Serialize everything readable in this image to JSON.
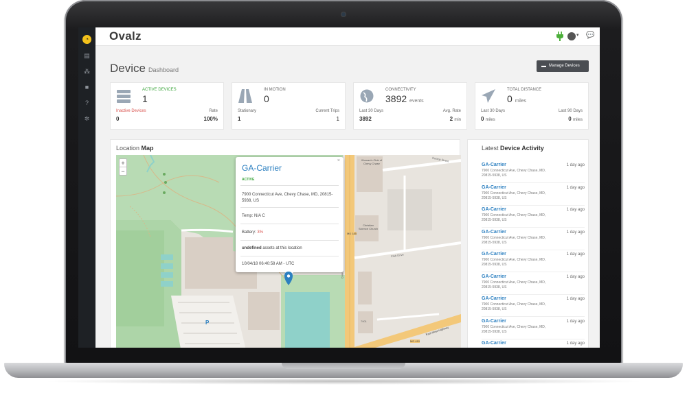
{
  "app": {
    "brand": "Ovalz"
  },
  "page": {
    "title": "Device",
    "subtitle": "Dashboard"
  },
  "toolbar": {
    "manage_devices_label": "Manage Devices"
  },
  "stats": [
    {
      "label": "Active Devices",
      "value": "1",
      "unit": "",
      "sub_left_label": "Inactive Devices",
      "sub_left_value": "0",
      "sub_left_unit": "",
      "sub_right_label": "Rate",
      "sub_right_value": "100%",
      "sub_right_unit": "",
      "icon": "server-icon"
    },
    {
      "label": "In Motion",
      "value": "0",
      "unit": "",
      "sub_left_label": "Stationary",
      "sub_left_value": "1",
      "sub_left_unit": "",
      "sub_right_label": "Current Trips",
      "sub_right_value": "1",
      "sub_right_unit": "",
      "icon": "road-icon"
    },
    {
      "label": "Connectivity",
      "value": "3892",
      "unit": "events",
      "sub_left_label": "Last 30 Days",
      "sub_left_value": "3892",
      "sub_left_unit": "",
      "sub_right_label": "Avg. Rate",
      "sub_right_value": "2",
      "sub_right_unit": "min",
      "icon": "globe-icon"
    },
    {
      "label": "Total Distance",
      "value": "0",
      "unit": "miles",
      "sub_left_label": "Last 30 Days",
      "sub_left_value": "0",
      "sub_left_unit": "miles",
      "sub_right_label": "Last 90 Days",
      "sub_right_value": "0",
      "sub_right_unit": "miles",
      "icon": "paper-plane-icon"
    }
  ],
  "map": {
    "title_prefix": "Location",
    "title_bold": "Map",
    "zoom_in": "+",
    "zoom_out": "−",
    "popup": {
      "title": "GA-Carrier",
      "status": "ACTIVE",
      "address": "7900 Connecticut Ave, Chevy Chase, MD, 20815-5938, US",
      "temp": "Temp: N/A C",
      "battery_label": "Battery:",
      "battery_value": "3%",
      "assets_bold": "undefined",
      "assets_rest": "assets at this location",
      "timestamp": "10/04/18 06:40:58 AM - UTC",
      "close": "×"
    },
    "labels": {
      "womens_club": "Woman's Club of Chevy Chase",
      "christian_science": "Christian Science Church",
      "dunlop": "Dunlop Street",
      "club_drive": "Club Drive",
      "md185": "MD 185",
      "connecticut": "Connecticut Avenue",
      "md410": "MD 410",
      "east_west": "East West Highway",
      "parking": "P",
      "building_num": "7901"
    }
  },
  "activity": {
    "title_prefix": "Latest",
    "title_bold": "Device Activity",
    "items": [
      {
        "name": "GA-Carrier",
        "address": "7900 Connecticut Ave, Chevy Chase, MD, 20815-5938, US",
        "time": "1 day ago"
      },
      {
        "name": "GA-Carrier",
        "address": "7900 Connecticut Ave, Chevy Chase, MD, 20815-5938, US",
        "time": "1 day ago"
      },
      {
        "name": "GA-Carrier",
        "address": "7900 Connecticut Ave, Chevy Chase, MD, 20815-5938, US",
        "time": "1 day ago"
      },
      {
        "name": "GA-Carrier",
        "address": "7900 Connecticut Ave, Chevy Chase, MD, 20815-5938, US",
        "time": "1 day ago"
      },
      {
        "name": "GA-Carrier",
        "address": "7900 Connecticut Ave, Chevy Chase, MD, 20815-5938, US",
        "time": "1 day ago"
      },
      {
        "name": "GA-Carrier",
        "address": "7900 Connecticut Ave, Chevy Chase, MD, 20815-5938, US",
        "time": "1 day ago"
      },
      {
        "name": "GA-Carrier",
        "address": "7900 Connecticut Ave, Chevy Chase, MD, 20815-5938, US",
        "time": "1 day ago"
      },
      {
        "name": "GA-Carrier",
        "address": "7900 Connecticut Ave, Chevy Chase, MD, 20815-5938, US",
        "time": "1 day ago"
      },
      {
        "name": "GA-Carrier",
        "address": "",
        "time": "1 day ago"
      }
    ]
  },
  "colors": {
    "accent_blue": "#2b7fc0",
    "active_green": "#3aa43a",
    "inactive_red": "#d9534f",
    "logo_yellow": "#f3c11b",
    "sidebar_dark": "#1e2125"
  },
  "icons": {
    "sidebar": [
      "logo-icon",
      "dashboard-icon",
      "sitemap-icon",
      "truck-icon",
      "help-icon",
      "settings-icon"
    ],
    "topbar": [
      "plug-icon",
      "user-icon",
      "chat-icon"
    ]
  }
}
